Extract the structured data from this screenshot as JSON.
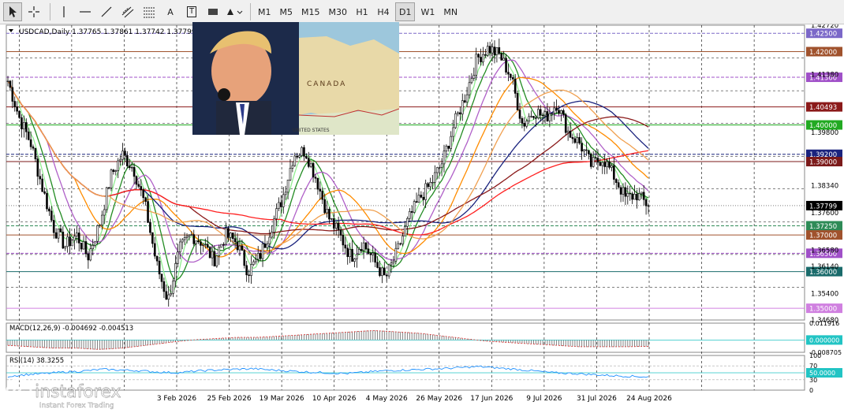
{
  "toolbar": {
    "tools": [
      {
        "icon": "cursor-icon"
      },
      {
        "icon": "crosshair-icon"
      },
      {
        "icon": "vertical-line-icon"
      },
      {
        "icon": "horizontal-line-icon"
      },
      {
        "icon": "trendline-icon"
      },
      {
        "icon": "channel-icon"
      },
      {
        "icon": "fibonacci-icon"
      },
      {
        "icon": "text-icon",
        "label": "A"
      },
      {
        "icon": "text-label-icon",
        "label": "T"
      },
      {
        "icon": "rectangle-icon"
      },
      {
        "icon": "shapes-icon"
      }
    ],
    "timeframes": [
      "M1",
      "M5",
      "M15",
      "M30",
      "H1",
      "H4",
      "D1",
      "W1",
      "MN"
    ],
    "active_timeframe": "D1"
  },
  "symbol_info": "USDCAD,Daily  1.37765 1.37861 1.37742 1.37799",
  "overlay_map": {
    "label_country": "CANADA",
    "label_us": "UNITED STATES"
  },
  "chart_data": {
    "type": "candlestick",
    "title": "USDCAD,Daily",
    "ohlc_last": {
      "open": 1.37765,
      "high": 1.37861,
      "low": 1.37742,
      "close": 1.37799
    },
    "x_tick_labels": [
      "3 Feb 2026",
      "25 Feb 2026",
      "19 Mar 2026",
      "10 Apr 2026",
      "4 May 2026",
      "26 May 2026",
      "17 Jun 2026",
      "9 Jul 2026",
      "31 Jul 2026",
      "24 Aug 2026"
    ],
    "y_tick_labels": [
      "1.42720",
      "1.41380",
      "1.39800",
      "1.38340",
      "1.37600",
      "1.36580",
      "1.36140",
      "1.35400",
      "1.34680"
    ],
    "ylim": [
      1.3468,
      1.4272
    ],
    "price_close_path": [
      1.412,
      1.402,
      1.395,
      1.383,
      1.372,
      1.367,
      1.37,
      1.364,
      1.373,
      1.386,
      1.392,
      1.388,
      1.378,
      1.362,
      1.352,
      1.366,
      1.37,
      1.368,
      1.363,
      1.37,
      1.368,
      1.36,
      1.364,
      1.372,
      1.38,
      1.392,
      1.393,
      1.385,
      1.375,
      1.37,
      1.364,
      1.368,
      1.363,
      1.358,
      1.365,
      1.374,
      1.38,
      1.384,
      1.39,
      1.4,
      1.408,
      1.418,
      1.421,
      1.419,
      1.413,
      1.4,
      1.404,
      1.402,
      1.406,
      1.398,
      1.395,
      1.389,
      1.391,
      1.386,
      1.38,
      1.381,
      1.378
    ],
    "horizontal_levels": [
      {
        "price": "1.42500",
        "color": "#7b68c8",
        "style": "dash"
      },
      {
        "price": "1.42000",
        "color": "#a0522d",
        "style": "solid"
      },
      {
        "price": "1.41300",
        "color": "#a050c8",
        "style": "dash"
      },
      {
        "price": "1.40493",
        "color": "#8b1a1a",
        "style": "solid"
      },
      {
        "price": "1.40000",
        "color": "#22aa22",
        "style": "solid"
      },
      {
        "price": "1.39200",
        "color": "#1a237e",
        "style": "dash"
      },
      {
        "price": "1.39000",
        "color": "#7b1a1a",
        "style": "solid"
      },
      {
        "price": "1.37799",
        "color": "#000000",
        "style": "current"
      },
      {
        "price": "1.37250",
        "color": "#2e8b57",
        "style": "dash"
      },
      {
        "price": "1.37000",
        "color": "#a0522d",
        "style": "solid"
      },
      {
        "price": "1.36500",
        "color": "#a050c8",
        "style": "dash"
      },
      {
        "price": "1.36000",
        "color": "#1a6b6b",
        "style": "solid"
      },
      {
        "price": "1.35000",
        "color": "#d080e0",
        "style": "solid"
      }
    ],
    "moving_average_colors": [
      "#90ee90",
      "#228b22",
      "#b060c8",
      "#ff8c00",
      "#1a237e",
      "#8b1a1a",
      "#ff2020",
      "#f0a050"
    ],
    "macd": {
      "label": "MACD(12,26,9) -0.004692 -0.004513",
      "y_tick_labels": [
        "0.011916",
        "0.000000",
        "-0.008705"
      ],
      "ylim": [
        -0.008705,
        0.011916
      ],
      "zero_color": "#22c4c4",
      "histogram": [
        -0.004,
        -0.005,
        -0.006,
        -0.006,
        -0.007,
        -0.006,
        -0.004,
        -0.002,
        0.0,
        0.001,
        0.002,
        0.002,
        0.003,
        0.004,
        0.005,
        0.006,
        0.007,
        0.006,
        0.005,
        0.003,
        0.001,
        -0.001,
        -0.002,
        -0.003,
        -0.004,
        -0.005,
        -0.005,
        -0.005,
        -0.0047
      ]
    },
    "rsi": {
      "label": "RSI(14) 38.3255",
      "y_tick_labels": [
        "100",
        "70",
        "50.0000",
        "30",
        "0"
      ],
      "ylim": [
        0,
        100
      ],
      "values": [
        40,
        45,
        48,
        52,
        55,
        60,
        58,
        56,
        52,
        50,
        55,
        58,
        60,
        62,
        58,
        55,
        52,
        50,
        48,
        52,
        56,
        58,
        60,
        62,
        65,
        68,
        64,
        60,
        55,
        50,
        48,
        45,
        42,
        40,
        38.3255
      ]
    }
  },
  "logo": {
    "brand": "instaforex",
    "tagline": "Instant Forex Trading"
  },
  "colors": {
    "accent": "#22aa22",
    "current_price_bg": "#000000",
    "watermark": "#ffffff"
  }
}
